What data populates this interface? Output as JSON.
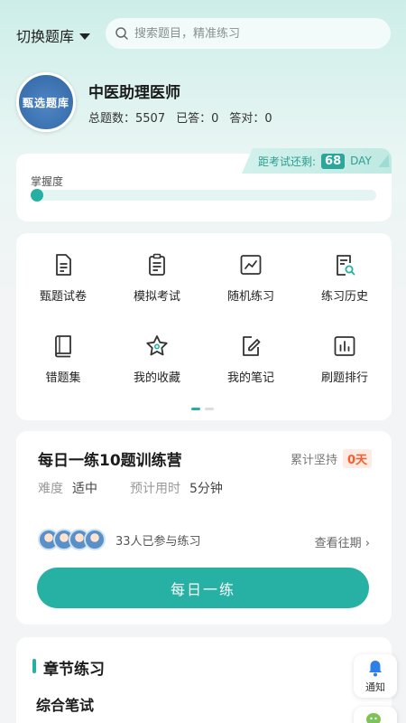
{
  "header": {
    "switch_label": "切换题库",
    "search_placeholder": "搜索题目，精准练习"
  },
  "profile": {
    "avatar_text": "甄选题库",
    "title": "中医助理医师",
    "total_label": "总题数：",
    "total_value": "5507",
    "answered_label": "已答：",
    "answered_value": "0",
    "correct_label": "答对：",
    "correct_value": "0"
  },
  "exam": {
    "countdown_label": "距考试还剩:",
    "days": "68",
    "unit": "DAY"
  },
  "mastery": {
    "label": "掌握度",
    "progress": 0
  },
  "menu": {
    "items": [
      {
        "label": "甄题试卷",
        "icon": "document-icon"
      },
      {
        "label": "模拟考试",
        "icon": "clipboard-icon"
      },
      {
        "label": "随机练习",
        "icon": "trend-chart-icon"
      },
      {
        "label": "练习历史",
        "icon": "history-search-icon"
      },
      {
        "label": "错题集",
        "icon": "book-icon"
      },
      {
        "label": "我的收藏",
        "icon": "star-icon"
      },
      {
        "label": "我的笔记",
        "icon": "edit-note-icon"
      },
      {
        "label": "刷题排行",
        "icon": "bar-chart-icon"
      }
    ],
    "page_count": 2,
    "active_page": 0
  },
  "daily": {
    "title": "每日一练10题训练营",
    "streak_label": "累计坚持",
    "streak_value": "0天",
    "difficulty_label": "难度",
    "difficulty_value": "适中",
    "time_label": "预计用时",
    "time_value": "5分钟",
    "participants": "33人已参与练习",
    "past_label": "查看往期",
    "button_label": "每日一练"
  },
  "chapter": {
    "title": "章节练习",
    "subtitle": "综合笔试"
  },
  "fab": {
    "notify_label": "通知"
  },
  "colors": {
    "accent": "#26b0a4",
    "streak": "#ff5a2a"
  }
}
